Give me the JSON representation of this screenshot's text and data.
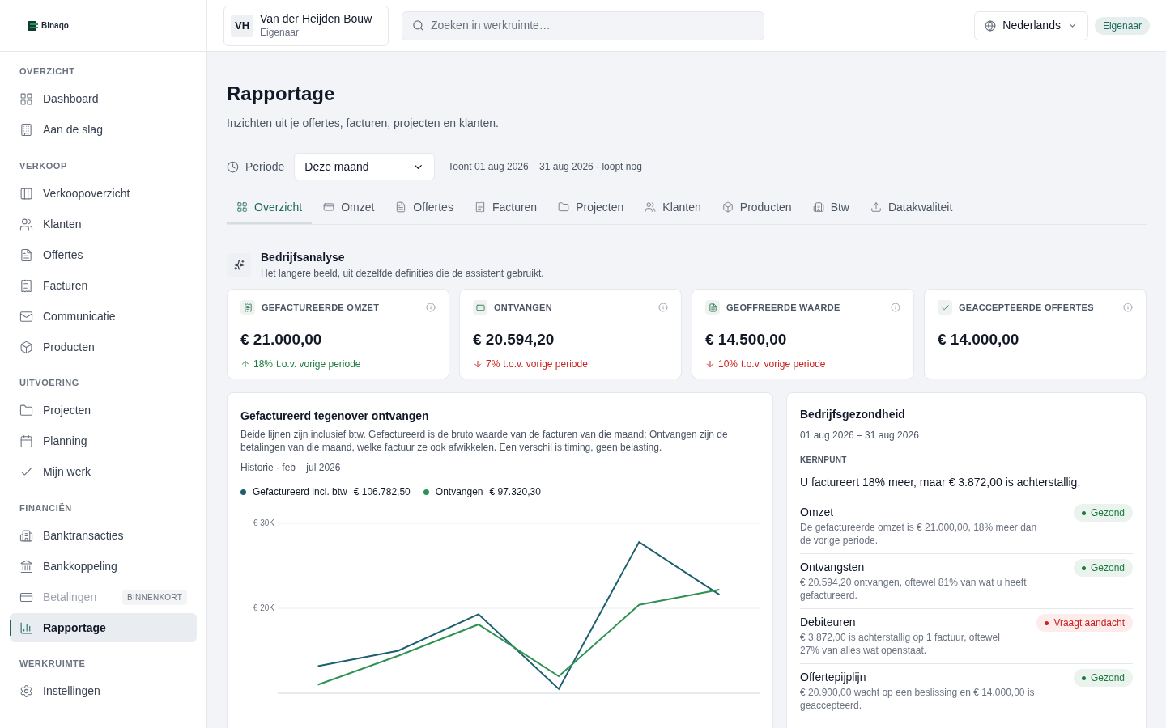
{
  "sidebar": {
    "logo": "Binaqo",
    "sections": [
      {
        "title": "OVERZICHT",
        "items": [
          {
            "label": "Dashboard",
            "selected": false,
            "disabled": false
          },
          {
            "label": "Aan de slag",
            "selected": false,
            "disabled": false
          }
        ]
      },
      {
        "title": "VERKOOP",
        "items": [
          {
            "label": "Verkoopoverzicht",
            "selected": false,
            "disabled": false
          },
          {
            "label": "Klanten",
            "selected": false,
            "disabled": false
          },
          {
            "label": "Offertes",
            "selected": false,
            "disabled": false
          },
          {
            "label": "Facturen",
            "selected": false,
            "disabled": false
          },
          {
            "label": "Communicatie",
            "selected": false,
            "disabled": false
          },
          {
            "label": "Producten",
            "selected": false,
            "disabled": false
          }
        ]
      },
      {
        "title": "UITVOERING",
        "items": [
          {
            "label": "Projecten",
            "selected": false,
            "disabled": false
          },
          {
            "label": "Planning",
            "selected": false,
            "disabled": false
          },
          {
            "label": "Mijn werk",
            "selected": false,
            "disabled": false
          }
        ]
      },
      {
        "title": "FINANCIËN",
        "items": [
          {
            "label": "Banktransacties",
            "selected": false,
            "disabled": false
          },
          {
            "label": "Bankkoppeling",
            "selected": false,
            "disabled": false
          },
          {
            "label": "Betalingen",
            "selected": false,
            "disabled": true,
            "badge": "BINNENKORT"
          },
          {
            "label": "Rapportage",
            "selected": true,
            "disabled": false
          }
        ]
      },
      {
        "title": "WERKRUIMTE",
        "items": [
          {
            "label": "Instellingen",
            "selected": false,
            "disabled": false
          }
        ]
      }
    ]
  },
  "header": {
    "workspace": {
      "initials": "VH",
      "name": "Van der Heijden Bouw",
      "role": "Eigenaar"
    },
    "search": {
      "placeholder": "Zoeken in werkruimte…"
    },
    "language": "Nederlands",
    "role_badge": "Eigenaar"
  },
  "page": {
    "title": "Rapportage",
    "subtitle": "Inzichten uit je offertes, facturen, projecten en klanten.",
    "period": {
      "label": "Periode",
      "value": "Deze maand",
      "note": "Toont 01 aug 2026 – 31 aug 2026 · loopt nog"
    },
    "tabs": [
      {
        "label": "Overzicht",
        "selected": true
      },
      {
        "label": "Omzet",
        "selected": false
      },
      {
        "label": "Offertes",
        "selected": false
      },
      {
        "label": "Facturen",
        "selected": false
      },
      {
        "label": "Projecten",
        "selected": false
      },
      {
        "label": "Klanten",
        "selected": false
      },
      {
        "label": "Producten",
        "selected": false
      },
      {
        "label": "Btw",
        "selected": false
      },
      {
        "label": "Datakwaliteit",
        "selected": false
      }
    ]
  },
  "analysis": {
    "title": "Bedrijfsanalyse",
    "subtitle": "Het langere beeld, uit dezelfde definities die de assistent gebruikt.",
    "kpis": [
      {
        "label": "GEFACTUREERDE OMZET",
        "value": "€ 21.000,00",
        "increase": true,
        "percent": "18%",
        "comparison": "t.o.v. vorige periode"
      },
      {
        "label": "ONTVANGEN",
        "value": "€ 20.594,20",
        "increase": false,
        "percent": "7%",
        "comparison": "t.o.v. vorige periode"
      },
      {
        "label": "GEOFFREERDE WAARDE",
        "value": "€ 14.500,00",
        "increase": false,
        "percent": "10%",
        "comparison": "t.o.v. vorige periode"
      },
      {
        "label": "GEACCEPTEERDE OFFERTES",
        "value": "€ 14.000,00"
      }
    ]
  },
  "chart_card": {
    "title": "Gefactureerd tegenover ontvangen",
    "description": "Beide lijnen zijn inclusief btw. Gefactureerd is de bruto waarde van de facturen van die maand; Ontvangen zijn de betalingen van die maand, welke factuur ze ook afwikkelen. Een verschil is timing, geen belasting.",
    "history": "Historie · feb – jul 2026",
    "legend": [
      {
        "total": "€ 106.782,50"
      },
      {
        "total": "€ 97.320,30"
      }
    ],
    "chart_data": {
      "type": "line",
      "ylim": [
        10000,
        30000
      ],
      "yticks": [
        {
          "value": 20000,
          "label": "€ 20K"
        },
        {
          "value": 30000,
          "label": "€ 30K"
        }
      ],
      "series": [
        {
          "name": "Gefactureerd incl. btw",
          "color": "#1e5f6e",
          "values": [
            13200,
            15000,
            19300,
            10500,
            27800,
            21600
          ]
        },
        {
          "name": "Ontvangen",
          "color": "#2f9254",
          "values": [
            11000,
            14400,
            18100,
            12000,
            20400,
            22200
          ]
        }
      ]
    }
  },
  "health": {
    "title": "Bedrijfsgezondheid",
    "period": "01 aug 2026 – 31 aug 2026",
    "key_label": "KERNPUNT",
    "key_text": "U factureert 18% meer, maar € 3.872,00 is achterstallig.",
    "items": [
      {
        "title": "Omzet",
        "text": "De gefactureerde omzet is € 21.000,00, 18% meer dan de vorige periode.",
        "status": "Gezond",
        "kind": "good"
      },
      {
        "title": "Ontvangsten",
        "text": "€ 20.594,20 ontvangen, oftewel 81% van wat u heeft gefactureerd.",
        "status": "Gezond",
        "kind": "good"
      },
      {
        "title": "Debiteuren",
        "text": "€ 3.872,00 is achterstallig op 1 factuur, oftewel 27% van alles wat openstaat.",
        "status": "Vraagt aandacht",
        "kind": "attention"
      },
      {
        "title": "Offertepijplijn",
        "text": "€ 20.900,00 wacht op een beslissing en € 14.000,00 is geaccepteerd.",
        "status": "Gezond",
        "kind": "good"
      }
    ]
  }
}
